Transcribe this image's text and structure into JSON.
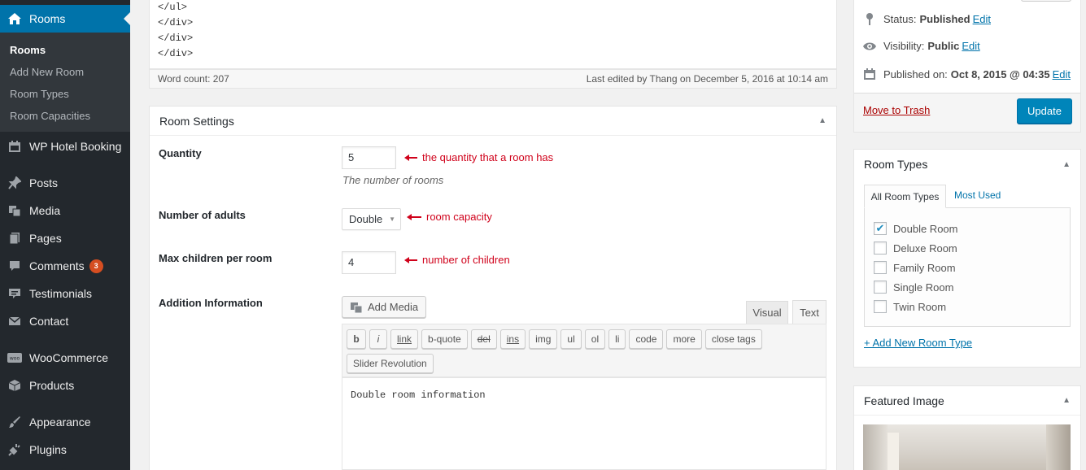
{
  "sidebar": {
    "current": "Rooms",
    "submenu": [
      "Rooms",
      "Add New Room",
      "Room Types",
      "Room Capacities"
    ],
    "items": [
      {
        "label": "WP Hotel Booking",
        "icon": "calendar-icon"
      },
      {
        "label": "Posts",
        "icon": "pin-icon"
      },
      {
        "label": "Media",
        "icon": "media-icon"
      },
      {
        "label": "Pages",
        "icon": "pages-icon"
      },
      {
        "label": "Comments",
        "icon": "comment-icon",
        "badge": "3"
      },
      {
        "label": "Testimonials",
        "icon": "testimonial-icon"
      },
      {
        "label": "Contact",
        "icon": "mail-icon"
      },
      {
        "label": "WooCommerce",
        "icon": "woo-icon"
      },
      {
        "label": "Products",
        "icon": "box-icon"
      },
      {
        "label": "Appearance",
        "icon": "brush-icon"
      },
      {
        "label": "Plugins",
        "icon": "plug-icon"
      }
    ]
  },
  "editor": {
    "code_lines": [
      "</ul>",
      "</div>",
      "</div>",
      "</div>"
    ],
    "word_count": "Word count: 207",
    "last_edited": "Last edited by Thang on December 5, 2016 at 10:14 am"
  },
  "room_settings": {
    "title": "Room Settings",
    "quantity_label": "Quantity",
    "quantity_value": "5",
    "quantity_note": "the quantity that a room has",
    "quantity_desc": "The number of rooms",
    "adults_label": "Number of adults",
    "adults_value": "Double",
    "adults_note": "room capacity",
    "children_label": "Max children per room",
    "children_value": "4",
    "children_note": "number of children",
    "addinfo_label": "Addition Information",
    "add_media": "Add Media",
    "tab_visual": "Visual",
    "tab_text": "Text",
    "quicktags": [
      "b",
      "i",
      "link",
      "b-quote",
      "del",
      "ins",
      "img",
      "ul",
      "ol",
      "li",
      "code",
      "more",
      "close tags"
    ],
    "slider_revolution": "Slider Revolution",
    "content": "Double room information"
  },
  "publish": {
    "status_label": "Status:",
    "status_value": "Published",
    "visibility_label": "Visibility:",
    "visibility_value": "Public",
    "published_label": "Published on:",
    "published_value": "Oct 8, 2015 @ 04:35",
    "edit": "Edit",
    "trash": "Move to Trash",
    "update": "Update"
  },
  "room_types": {
    "title": "Room Types",
    "tab_all": "All Room Types",
    "tab_most": "Most Used",
    "types": [
      {
        "label": "Double Room",
        "checked": true
      },
      {
        "label": "Deluxe Room",
        "checked": false
      },
      {
        "label": "Family Room",
        "checked": false
      },
      {
        "label": "Single Room",
        "checked": false
      },
      {
        "label": "Twin Room",
        "checked": false
      }
    ],
    "add_new": "+ Add New Room Type"
  },
  "featured": {
    "title": "Featured Image"
  },
  "colors": {
    "accent": "#0073aa",
    "sidebar": "#23282d",
    "annotation": "#d0021b"
  }
}
